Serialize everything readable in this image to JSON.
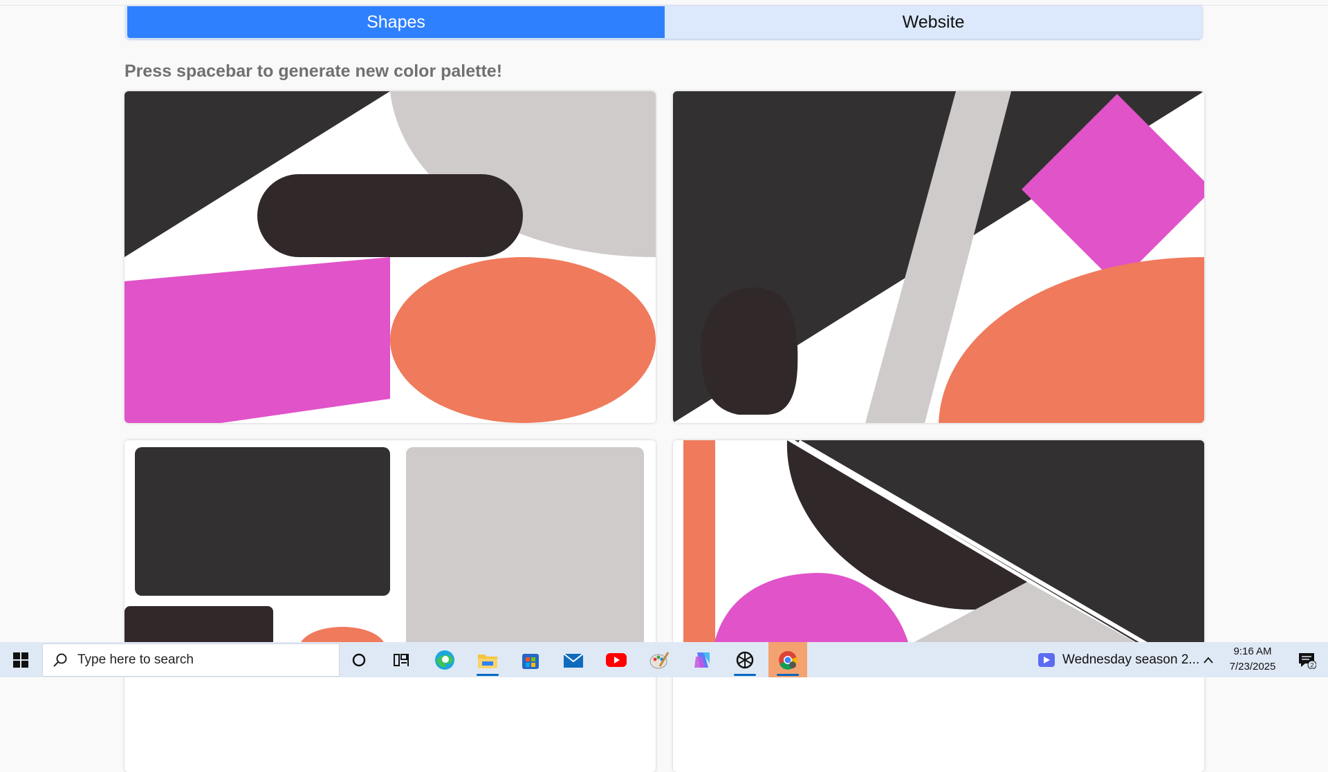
{
  "tabs": [
    {
      "label": "Shapes",
      "active": true
    },
    {
      "label": "Website",
      "active": false
    }
  ],
  "hint": "Press spacebar to generate new color palette!",
  "palette": {
    "dark": "#333031",
    "dark_brown": "#302829",
    "light_gray": "#d0cbcb",
    "magenta": "#e153c8",
    "salmon": "#ef7a5c",
    "white": "#ffffff",
    "accent_blue": "#2f80ff",
    "tab_bg": "#dce8fb"
  },
  "taskbar": {
    "search_placeholder": "Type here to search",
    "news_text": "Wednesday season 2...",
    "time": "9:16 AM",
    "date": "7/23/2025",
    "notification_count": "2",
    "pinned_icons": [
      "cortana-icon",
      "task-view-icon",
      "edge-icon",
      "file-explorer-icon",
      "store-icon",
      "mail-icon",
      "youtube-icon",
      "paint-icon",
      "copilot-icon",
      "chatgpt-icon",
      "chrome-icon"
    ]
  }
}
